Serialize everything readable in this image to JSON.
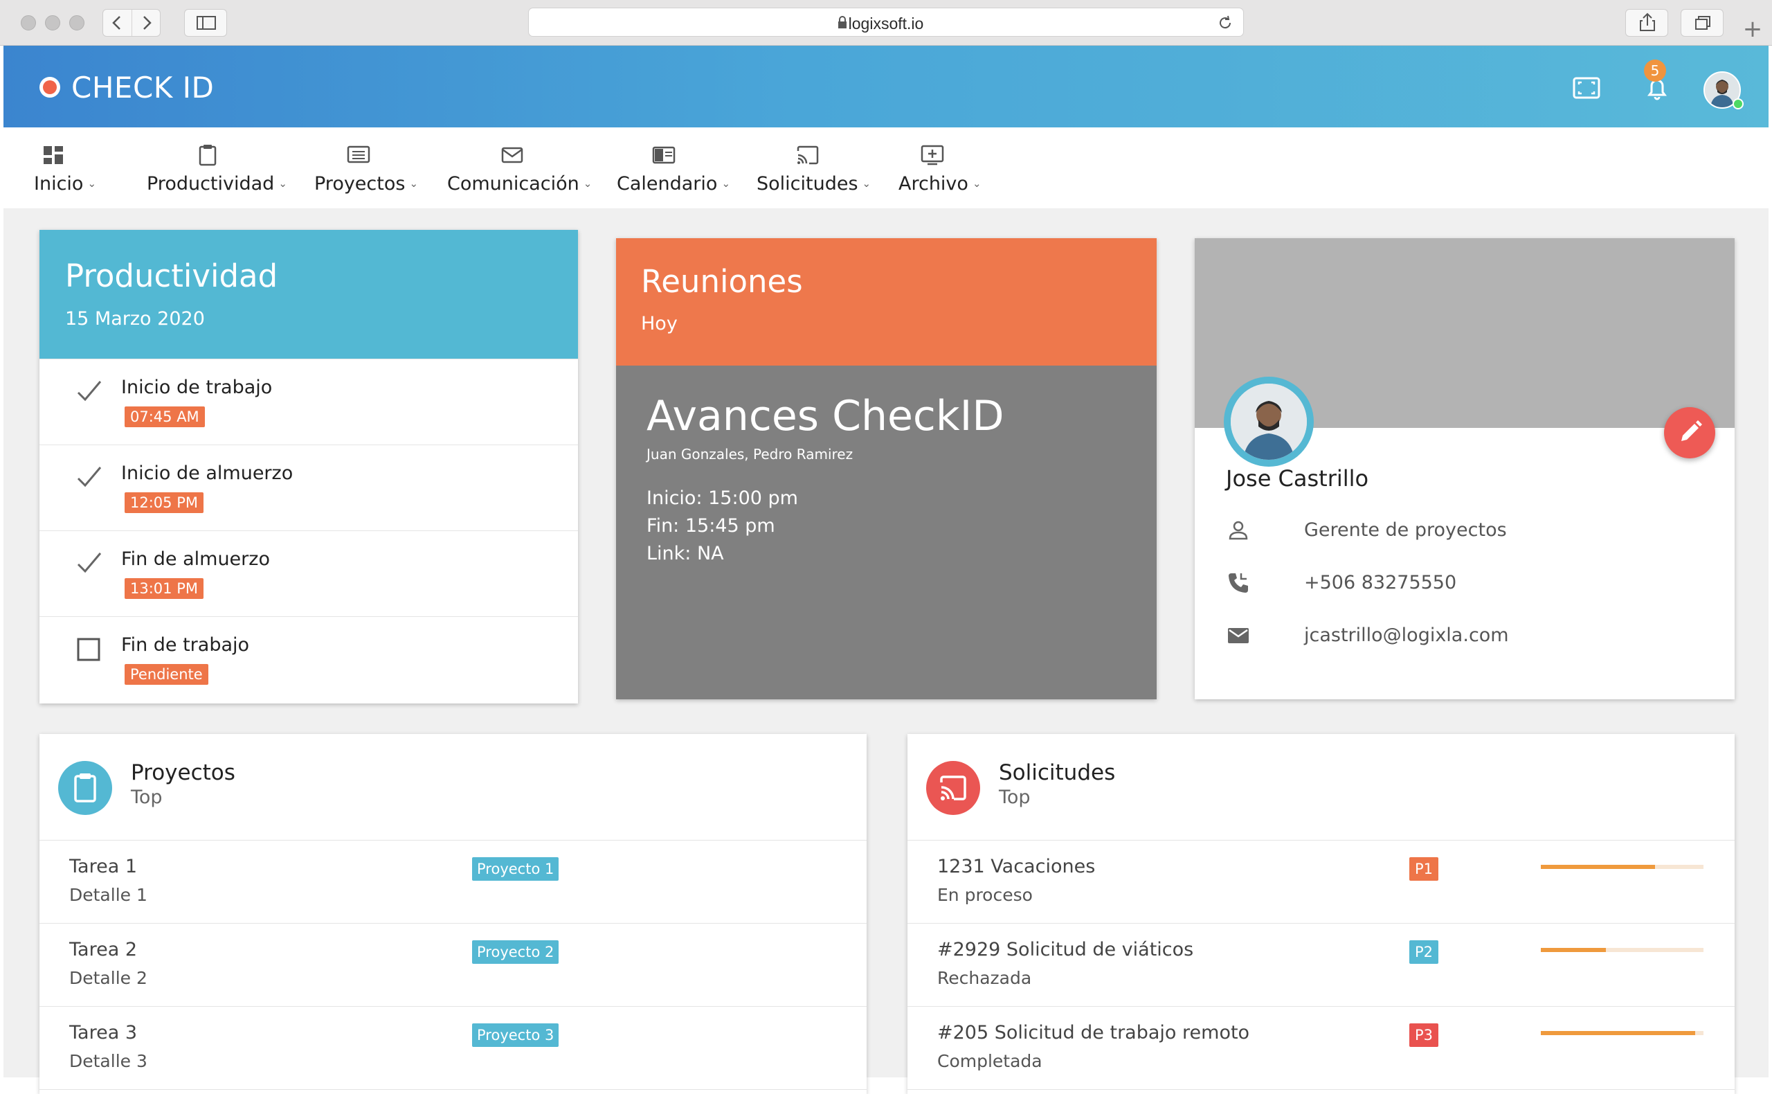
{
  "browser": {
    "url": "logixsoft.io"
  },
  "app": {
    "brand": "CHECK ID",
    "notification_count": "5"
  },
  "menu": [
    {
      "label": "Inicio",
      "icon": "dashboard-icon"
    },
    {
      "label": "Productividad",
      "icon": "clipboard-icon"
    },
    {
      "label": "Proyectos",
      "icon": "list-icon"
    },
    {
      "label": "Comunicación",
      "icon": "mail-icon"
    },
    {
      "label": "Calendario",
      "icon": "calendar-icon"
    },
    {
      "label": "Solicitudes",
      "icon": "cast-icon"
    },
    {
      "label": "Archivo",
      "icon": "archive-icon"
    }
  ],
  "productividad": {
    "title": "Productividad",
    "date": "15 Marzo 2020",
    "items": [
      {
        "label": "Inicio de trabajo",
        "tag": "07:45 AM",
        "done": true
      },
      {
        "label": "Inicio de almuerzo",
        "tag": "12:05 PM",
        "done": true
      },
      {
        "label": "Fin de almuerzo",
        "tag": "13:01 PM",
        "done": true
      },
      {
        "label": "Fin de trabajo",
        "tag": "Pendiente",
        "done": false
      }
    ]
  },
  "reuniones": {
    "title": "Reuniones",
    "subtitle": "Hoy",
    "meeting_title": "Avances CheckID",
    "people": "Juan Gonzales, Pedro Ramirez",
    "start": "Inicio: 15:00 pm",
    "end": "Fin: 15:45 pm",
    "link": "Link: NA"
  },
  "profile": {
    "name": "Jose Castrillo",
    "role": "Gerente de proyectos",
    "phone": "+506 83275550",
    "email": "jcastrillo@logixla.com"
  },
  "proyectos": {
    "title": "Proyectos",
    "subtitle": "Top",
    "rows": [
      {
        "title": "Tarea 1",
        "detail": "Detalle 1",
        "tag": "Proyecto 1"
      },
      {
        "title": "Tarea 2",
        "detail": "Detalle 2",
        "tag": "Proyecto 2"
      },
      {
        "title": "Tarea 3",
        "detail": "Detalle 3",
        "tag": "Proyecto 3"
      }
    ]
  },
  "solicitudes": {
    "title": "Solicitudes",
    "subtitle": "Top",
    "rows": [
      {
        "title": "1231 Vacaciones",
        "status": "En proceso",
        "priority": "P1",
        "priority_color": "#ee7548",
        "progress": 0.7
      },
      {
        "title": "#2929 Solicitud de viáticos",
        "status": "Rechazada",
        "priority": "P2",
        "priority_color": "#54b8d3",
        "progress": 0.4
      },
      {
        "title": "#205 Solicitud de trabajo remoto",
        "status": "Completada",
        "priority": "P3",
        "priority_color": "#e9524f",
        "progress": 0.95
      }
    ]
  },
  "colors": {
    "header_start": "#3b85cf",
    "header_end": "#59b9d9",
    "accent_blue": "#53b8d3",
    "accent_orange": "#ee784c",
    "accent_red": "#ee5a55"
  }
}
